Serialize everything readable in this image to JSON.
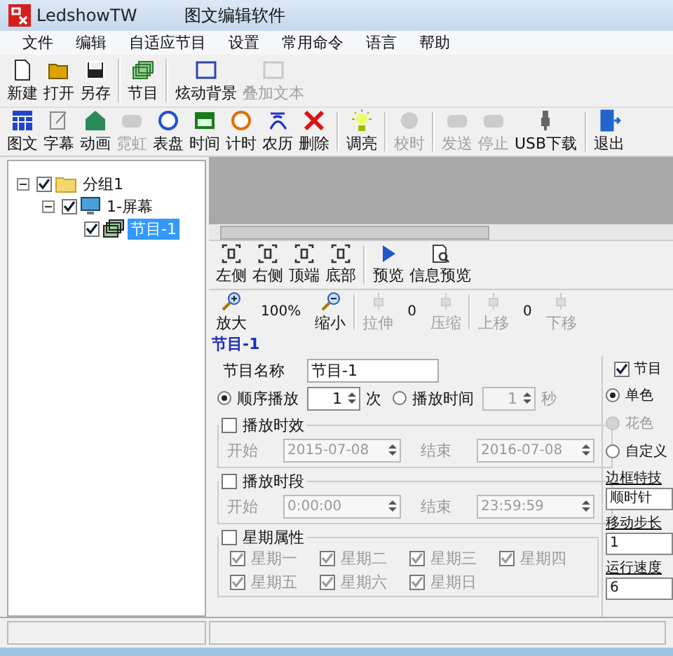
{
  "window": {
    "title": "LedshowTW",
    "subtitle": "图文编辑软件"
  },
  "menu": [
    "文件",
    "编辑",
    "自适应节目",
    "设置",
    "常用命令",
    "语言",
    "帮助"
  ],
  "toolbar_main": [
    [
      {
        "label": "新建",
        "disabled": false
      },
      {
        "label": "打开",
        "disabled": false
      },
      {
        "label": "另存",
        "disabled": false
      }
    ],
    [
      {
        "label": "节目",
        "disabled": false
      }
    ],
    [
      {
        "label": "炫动背景",
        "disabled": false
      },
      {
        "label": "叠加文本",
        "disabled": true
      }
    ]
  ],
  "toolbar_objects": [
    [
      {
        "label": "图文",
        "disabled": false
      },
      {
        "label": "字幕",
        "disabled": false
      },
      {
        "label": "动画",
        "disabled": false
      },
      {
        "label": "霓虹",
        "disabled": true
      },
      {
        "label": "表盘",
        "disabled": false
      },
      {
        "label": "时间",
        "disabled": false
      },
      {
        "label": "计时",
        "disabled": false
      },
      {
        "label": "农历",
        "disabled": false
      },
      {
        "label": "删除",
        "disabled": false
      }
    ],
    [
      {
        "label": "调亮",
        "disabled": false
      }
    ],
    [
      {
        "label": "校时",
        "disabled": true
      }
    ],
    [
      {
        "label": "发送",
        "disabled": true
      },
      {
        "label": "停止",
        "disabled": true
      },
      {
        "label": "USB下载",
        "disabled": false
      }
    ],
    [
      {
        "label": "退出",
        "disabled": false
      }
    ]
  ],
  "tree": [
    {
      "label": "分组1",
      "checked": true,
      "expanded": true,
      "selected": false,
      "children": [
        {
          "label": "1-屏幕",
          "checked": true,
          "expanded": true,
          "selected": false,
          "children": [
            {
              "label": "节目-1",
              "checked": true,
              "selected": true
            }
          ]
        }
      ]
    }
  ],
  "layout_toolbar": [
    [
      {
        "label": "左侧"
      },
      {
        "label": "右侧"
      },
      {
        "label": "顶端"
      },
      {
        "label": "底部"
      }
    ],
    [
      {
        "label": "预览"
      },
      {
        "label": "信息预览"
      }
    ]
  ],
  "zoom_toolbar": [
    [
      {
        "kind": "button",
        "label": "放大",
        "disabled": false
      },
      {
        "kind": "value",
        "label": "100%"
      },
      {
        "kind": "button",
        "label": "缩小",
        "disabled": false
      }
    ],
    [
      {
        "kind": "button",
        "label": "拉伸",
        "disabled": true
      },
      {
        "kind": "value",
        "label": "0"
      },
      {
        "kind": "button",
        "label": "压缩",
        "disabled": true
      }
    ],
    [
      {
        "kind": "button",
        "label": "上移",
        "disabled": true
      },
      {
        "kind": "value",
        "label": "0"
      },
      {
        "kind": "button",
        "label": "下移",
        "disabled": true
      }
    ]
  ],
  "program": {
    "heading": "节目-1",
    "name_label": "节目名称",
    "name": "节目-1",
    "play_modes": [
      {
        "label": "顺序播放",
        "selected": true,
        "count": "1",
        "unit": "次"
      },
      {
        "label": "播放时间",
        "selected": false,
        "count": "1",
        "unit": "秒"
      }
    ],
    "validity": {
      "label": "播放时效",
      "checked": false,
      "start_label": "开始",
      "start": "2015-07-08",
      "end_label": "结束",
      "end": "2016-07-08"
    },
    "period": {
      "label": "播放时段",
      "checked": false,
      "start_label": "开始",
      "start": "0:00:00",
      "end_label": "结束",
      "end": "23:59:59"
    },
    "weekdays": {
      "label": "星期属性",
      "checked": false,
      "days": [
        {
          "label": "星期一",
          "checked": true
        },
        {
          "label": "星期二",
          "checked": true
        },
        {
          "label": "星期三",
          "checked": true
        },
        {
          "label": "星期四",
          "checked": true
        },
        {
          "label": "星期五",
          "checked": true
        },
        {
          "label": "星期六",
          "checked": true
        },
        {
          "label": "星期日",
          "checked": true
        }
      ]
    }
  },
  "border": {
    "label": "节目",
    "checked": true,
    "colors": [
      {
        "label": "单色",
        "selected": true,
        "disabled": false
      },
      {
        "label": "花色",
        "selected": false,
        "disabled": true
      },
      {
        "label": "自定义",
        "selected": false,
        "disabled": false
      }
    ],
    "effect_label": "边框特技",
    "effect": "顺时针",
    "step_label": "移动步长",
    "step": "1",
    "speed_label": "运行速度",
    "speed": "6"
  }
}
